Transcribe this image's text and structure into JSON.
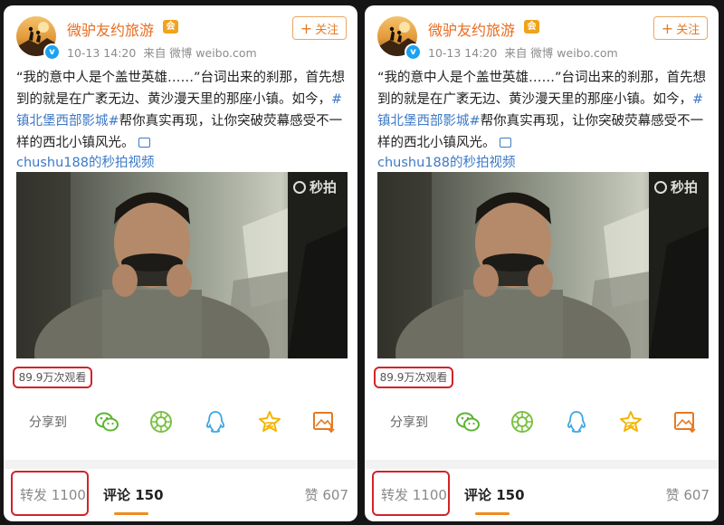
{
  "post": {
    "username": "微驴友约旅游",
    "member_badge": "会",
    "timestamp": "10-13 14:20",
    "source": "来自 微博 weibo.com",
    "follow_label": "关注",
    "text_part1": "“我的意中人是个盖世英雄……”台词出来的刹那，首先想到的就是在广袤无边、黄沙漫天里的那座小镇。如今，",
    "hashtag": "#镇北堡西部影城#",
    "text_part2": "帮你真实再现，让你突破荧幕感受不一样的西北小镇风光。",
    "video_link": "chushu188的秒拍视频",
    "watermark": "秒拍",
    "views": "89.9万次观看"
  },
  "share": {
    "label": "分享到",
    "icons": [
      "wechat-icon",
      "moments-icon",
      "qq-icon",
      "qzone-icon",
      "image-save-icon"
    ]
  },
  "tabs": {
    "repost": "转发 1100",
    "comment": "评论 150",
    "like": "赞 607"
  },
  "colors": {
    "accent": "#e86b1e",
    "link": "#3d79c6",
    "highlight_box": "#d2232a",
    "tab_underline": "#f08c1b"
  }
}
